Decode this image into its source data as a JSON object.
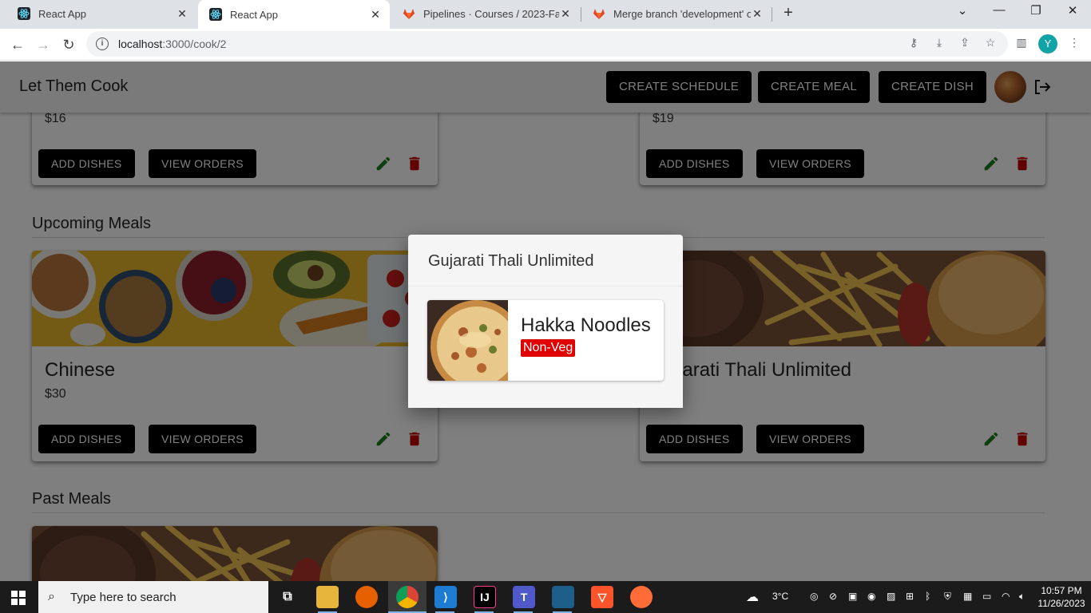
{
  "browser": {
    "tabs": [
      {
        "title": "React App",
        "active": false
      },
      {
        "title": "React App",
        "active": true
      },
      {
        "title": "Pipelines · Courses / 2023-Fall / ...",
        "active": false
      },
      {
        "title": "Merge branch 'development' of...",
        "active": false
      }
    ],
    "url_host": "localhost",
    "url_path": ":3000/cook/2",
    "profile_initial": "Y"
  },
  "app": {
    "brand": "Let Them Cook",
    "buttons": {
      "create_schedule": "CREATE SCHEDULE",
      "create_meal": "CREATE MEAL",
      "create_dish": "CREATE DISH"
    }
  },
  "top_cards": [
    {
      "price": "$16",
      "add_label": "ADD DISHES",
      "view_label": "VIEW ORDERS"
    },
    {
      "price": "$19",
      "add_label": "ADD DISHES",
      "view_label": "VIEW ORDERS"
    }
  ],
  "sections": {
    "upcoming": "Upcoming Meals",
    "past": "Past Meals"
  },
  "upcoming_cards": [
    {
      "name": "Chinese",
      "price": "$30",
      "add_label": "ADD DISHES",
      "view_label": "VIEW ORDERS"
    },
    {
      "name": "Gujarati Thali Unlimited",
      "price": "",
      "add_label": "ADD DISHES",
      "view_label": "VIEW ORDERS"
    }
  ],
  "dialog": {
    "title": "Gujarati Thali Unlimited",
    "dish": {
      "name": "Hakka Noodles",
      "tag": "Non-Veg"
    }
  },
  "taskbar": {
    "search_placeholder": "Type here to search",
    "weather": "3°C",
    "time": "10:57 PM",
    "date": "11/26/2023"
  },
  "colors": {
    "edit": "#1b7d1b",
    "delete": "#c40000",
    "tag_bg": "#e00000"
  }
}
